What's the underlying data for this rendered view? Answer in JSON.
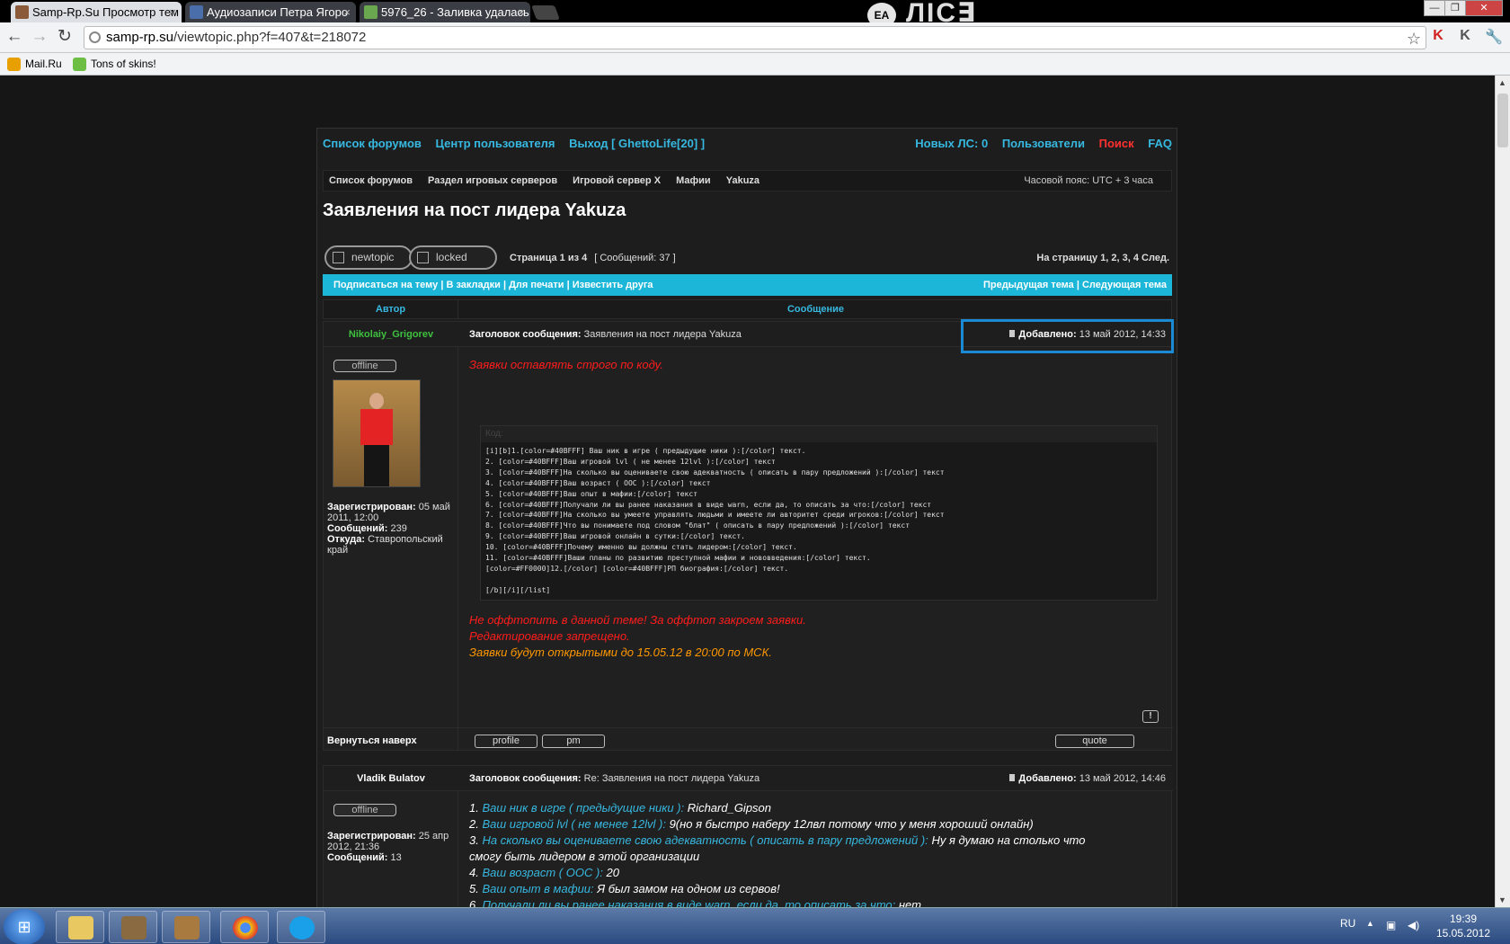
{
  "browser": {
    "tabs": [
      {
        "title": "Samp-Rp.Su Просмотр тем",
        "active": true,
        "color": "#8a5a3a"
      },
      {
        "title": "Аудиозаписи Петра Ягоро",
        "active": false,
        "color": "#4a6ea9"
      },
      {
        "title": "5976_26 - Заливка удалась",
        "active": false,
        "color": "#6aa84f"
      }
    ],
    "close_symbol": "×",
    "brand": "ЛIС∃",
    "brand_badge": "EA",
    "window_buttons": {
      "minimize": "—",
      "restore": "❐",
      "close": "✕"
    },
    "nav": {
      "back": "←",
      "forward": "→",
      "reload": "↻"
    },
    "url_domain": "samp-rp.su",
    "url_path": "/viewtopic.php?f=407&t=218072",
    "star": "☆",
    "bookmarks": [
      {
        "label": "Mail.Ru",
        "color": "#e8a000"
      },
      {
        "label": "Tons of skins!",
        "color": "#6cbe45"
      }
    ],
    "toolbar_icons": {
      "kaspersky": "K",
      "ext": "K",
      "wrench": "🔧"
    }
  },
  "forum": {
    "nav_left": [
      "Список форумов",
      "Центр пользователя",
      "Выход [ GhettoLife[20] ]"
    ],
    "nav_right": {
      "pm": "Новых ЛС: 0",
      "users": "Пользователи",
      "search": "Поиск",
      "faq": "FAQ"
    },
    "breadcrumb": [
      "Список форумов",
      "Раздел игровых серверов",
      "Игровой сервер X",
      "Мафии",
      "Yakuza"
    ],
    "timezone": "Часовой пояс: UTC + 3 часа",
    "title": "Заявления на пост лидера Yakuza",
    "buttons": {
      "newtopic": "newtopic",
      "locked": "locked"
    },
    "page_info": "Страница 1 из 4",
    "messages_count": "[ Сообщений: 37 ]",
    "page_links": "На страницу 1, 2, 3, 4  След.",
    "actions_left": "Подписаться на тему | В закладки | Для печати | Известить друга",
    "actions_right": "Предыдущая тема | Следующая тема",
    "col_author": "Автор",
    "col_message": "Сообщение",
    "subject_label": "Заголовок сообщения:",
    "added_label": "Добавлено:",
    "offline": "offline",
    "back_to_top": "Вернуться наверх",
    "btn_profile": "profile",
    "btn_pm": "pm",
    "btn_quote": "quote",
    "report": "!",
    "code_header": "Код:"
  },
  "posts": [
    {
      "author": "Nikolaiy_Grigorev",
      "author_color": "#3ec13e",
      "subject": "Заявления на пост лидера Yakuza",
      "date": "13 май 2012, 14:33",
      "reg_label": "Зарегистрирован:",
      "reg_date": "05 май 2011, 12:00",
      "msgs_label": "Сообщений:",
      "msgs": "239",
      "from_label": "Откуда:",
      "from": "Ставропольский край",
      "intro": "Заявки оставлять строго по коду.",
      "code": "[i][b]1.[color=#40BFFF] Ваш ник в игре ( предыдущие ники ):[/color] текст.\n2. [color=#40BFFF]Ваш игровой lvl ( не менее 12lvl ):[/color] текст\n3. [color=#40BFFF]На сколько вы оцениваете свою адекватность ( описать в пару предложений ):[/color] текст\n4. [color=#40BFFF]Ваш возраст ( OOC ):[/color] текст\n5. [color=#40BFFF]Ваш опыт в мафии:[/color] текст\n6. [color=#40BFFF]Получали ли вы ранее наказания в виде warn, если да, то описать за что:[/color] текст\n7. [color=#40BFFF]На сколько вы умеете управлять людьми и имеете ли авторитет среди игроков:[/color] текст\n8. [color=#40BFFF]Что вы понимаете под словом \"блат\" ( описать в пару предложений ):[/color] текст\n9. [color=#40BFFF]Ваш игровой онлайн в сутки:[/color] текст.\n10. [color=#40BFFF]Почему именно вы должны стать лидером:[/color] текст.\n11. [color=#40BFFF]Ваши планы по развитию преступной мафии и нововведения:[/color] текст.\n[color=#FF0000]12.[/color] [color=#40BFFF]РП биография:[/color] текст.\n\n[/b][/i][/list]",
      "warn1": "Не оффтопить в данной теме! За оффтоп закроем заявки.",
      "warn2": "Редактирование запрещено.",
      "warn3": "Заявки будут открытыми до 15.05.12 в 20:00 по МСК."
    },
    {
      "author": "Vladik Bulatov",
      "author_color": "#ffffff",
      "subject": "Re: Заявления на пост лидера Yakuza",
      "date": "13 май 2012, 14:46",
      "reg_label": "Зарегистрирован:",
      "reg_date": "25 апр 2012, 21:36",
      "msgs_label": "Сообщений:",
      "msgs": "13",
      "answers": [
        {
          "num": "1.",
          "q": "Ваш ник в игре ( предыдущие ники ):",
          "a": "Richard_Gipson"
        },
        {
          "num": "2.",
          "q": "Ваш игровой lvl ( не менее 12lvl ):",
          "a": "9(но я быстро наберу 12лвл потому что у меня хороший онлайн)"
        },
        {
          "num": "3.",
          "q": "На сколько вы оцениваете свою адекватность ( описать в пару предложений ):",
          "a": "Ну я думаю на столько что смогу быть лидером в этой организации"
        },
        {
          "num": "4.",
          "q": "Ваш возраст ( OOC ):",
          "a": "20"
        },
        {
          "num": "5.",
          "q": "Ваш опыт в мафии:",
          "a": "Я был замом на одном из сервов!"
        },
        {
          "num": "6.",
          "q": "Получали ли вы ранее наказания в виде warn, если да, то описать за что:",
          "a": "нет"
        }
      ]
    }
  ],
  "taskbar": {
    "start": "⊞",
    "lang": "RU",
    "time": "19:39",
    "date": "15.05.2012",
    "tray_up": "▲",
    "tray_net": "▣",
    "tray_vol": "◀)",
    "tray_flag": "▲",
    "items": [
      {
        "name": "explorer",
        "color": "#e8c860"
      },
      {
        "name": "game1",
        "color": "#8a6a40"
      },
      {
        "name": "game2",
        "color": "#a87a40"
      },
      {
        "name": "chrome",
        "color": "#e04030"
      },
      {
        "name": "skype",
        "color": "#1aa0e8"
      }
    ]
  }
}
